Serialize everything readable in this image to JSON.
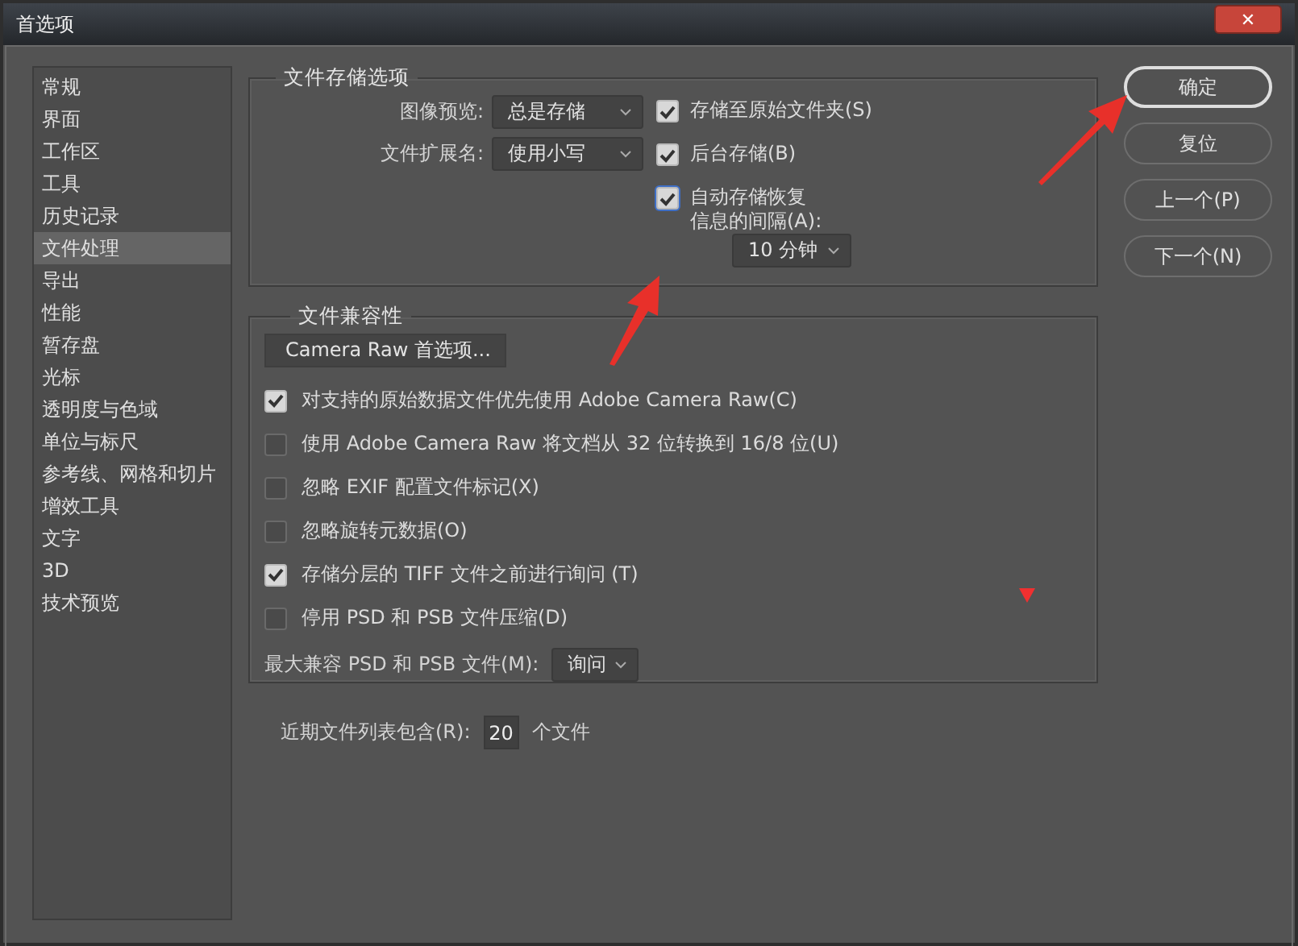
{
  "window": {
    "title": "首选项",
    "close_button": "✕"
  },
  "sidebar": {
    "items": [
      {
        "label": "常规",
        "selected": false
      },
      {
        "label": "界面",
        "selected": false
      },
      {
        "label": "工作区",
        "selected": false
      },
      {
        "label": "工具",
        "selected": false
      },
      {
        "label": "历史记录",
        "selected": false
      },
      {
        "label": "文件处理",
        "selected": true
      },
      {
        "label": "导出",
        "selected": false
      },
      {
        "label": "性能",
        "selected": false
      },
      {
        "label": "暂存盘",
        "selected": false
      },
      {
        "label": "光标",
        "selected": false
      },
      {
        "label": "透明度与色域",
        "selected": false
      },
      {
        "label": "单位与标尺",
        "selected": false
      },
      {
        "label": "参考线、网格和切片",
        "selected": false
      },
      {
        "label": "增效工具",
        "selected": false
      },
      {
        "label": "文字",
        "selected": false
      },
      {
        "label": "3D",
        "selected": false
      },
      {
        "label": "技术预览",
        "selected": false
      }
    ]
  },
  "file_saving": {
    "title": "文件存储选项",
    "dropdowns": [
      {
        "label": "图像预览:",
        "value": "总是存储"
      },
      {
        "label": "文件扩展名:",
        "value": "使用小写"
      }
    ],
    "checkboxes": [
      {
        "lines": [
          "存储至原始文件夹(S)"
        ],
        "checked": true
      },
      {
        "lines": [
          "后台存储(B)"
        ],
        "checked": true
      },
      {
        "lines": [
          "自动存储恢复",
          "信息的间隔(A):"
        ],
        "checked": true,
        "focused": true
      }
    ],
    "interval": {
      "value": "10 分钟"
    }
  },
  "compatibility": {
    "title": "文件兼容性",
    "camera_raw_button": "Camera Raw 首选项...",
    "checkboxes": [
      {
        "label": "对支持的原始数据文件优先使用 Adobe Camera Raw(C)",
        "checked": true
      },
      {
        "label": "使用 Adobe Camera Raw 将文档从 32 位转换到 16/8 位(U)",
        "checked": false
      },
      {
        "label": "忽略 EXIF 配置文件标记(X)",
        "checked": false
      },
      {
        "label": "忽略旋转元数据(O)",
        "checked": false
      },
      {
        "label": "存储分层的 TIFF 文件之前进行询问 (T)",
        "checked": true
      },
      {
        "label": "停用 PSD 和 PSB 文件压缩(D)",
        "checked": false
      }
    ],
    "max_compat": {
      "label": "最大兼容 PSD 和 PSB 文件(M):",
      "value": "询问"
    }
  },
  "recent_files": {
    "label": "近期文件列表包含(R):",
    "value": "20",
    "suffix": "个文件"
  },
  "buttons": [
    {
      "label": "确定",
      "default": true
    },
    {
      "label": "复位",
      "default": false
    },
    {
      "label": "上一个(P)",
      "default": false
    },
    {
      "label": "下一个(N)",
      "default": false
    }
  ]
}
